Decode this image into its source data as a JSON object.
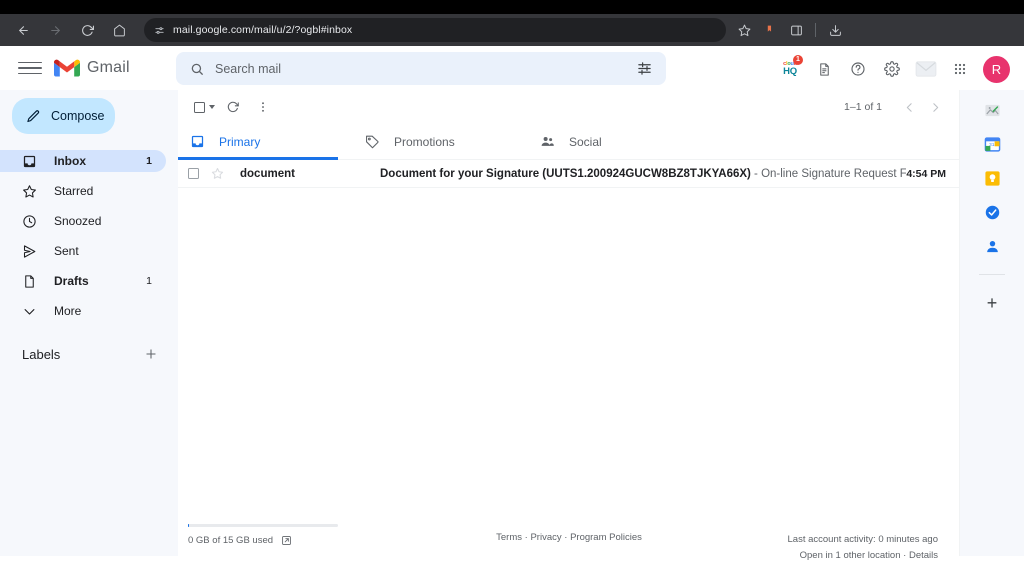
{
  "browser": {
    "url": "mail.google.com/mail/u/2/?ogbl#inbox",
    "back_icon": "back-arrow-icon",
    "forward_icon": "forward-arrow-icon",
    "reload_icon": "reload-icon",
    "home_icon": "home-icon",
    "site_settings_icon": "site-settings-icon",
    "bookmark_icon": "star-icon",
    "extension_icon": "extension-icon",
    "sidepanel_icon": "side-panel-icon",
    "download_icon": "download-icon"
  },
  "header": {
    "menu_icon": "hamburger-menu-icon",
    "logo_text": "Gmail",
    "search": {
      "placeholder": "Search mail",
      "value": "",
      "search_icon": "search-icon",
      "filter_icon": "tune-filter-icon"
    },
    "actions": {
      "cloudhq_top": "cloud",
      "cloudhq_bottom": "HQ",
      "cloudhq_badge": "1",
      "scan_icon": "document-scan-icon",
      "help_icon": "help-question-icon",
      "settings_icon": "settings-gear-icon",
      "envelope_icon": "envelope-icon",
      "apps_icon": "google-apps-grid-icon"
    },
    "avatar_initial": "R"
  },
  "sidebar": {
    "compose_label": "Compose",
    "compose_icon": "pencil-compose-icon",
    "items": [
      {
        "label": "Inbox",
        "count": "1",
        "icon": "inbox-icon",
        "active": true,
        "bold": true
      },
      {
        "label": "Starred",
        "count": "",
        "icon": "star-icon",
        "active": false,
        "bold": false
      },
      {
        "label": "Snoozed",
        "count": "",
        "icon": "clock-icon",
        "active": false,
        "bold": false
      },
      {
        "label": "Sent",
        "count": "",
        "icon": "send-icon",
        "active": false,
        "bold": false
      },
      {
        "label": "Drafts",
        "count": "1",
        "icon": "draft-file-icon",
        "active": false,
        "bold": true
      },
      {
        "label": "More",
        "count": "",
        "icon": "chevron-down-icon",
        "active": false,
        "bold": false
      }
    ],
    "labels_title": "Labels",
    "labels_add_icon": "plus-icon"
  },
  "list_toolbar": {
    "select_all_icon": "checkbox-icon",
    "select_caret_icon": "chevron-down-icon",
    "refresh_icon": "refresh-icon",
    "more_icon": "more-vertical-icon",
    "pagination_text": "1–1 of 1",
    "prev_icon": "chevron-left-icon",
    "next_icon": "chevron-right-icon"
  },
  "tabs": [
    {
      "label": "Primary",
      "icon": "inbox-tab-icon",
      "active": true
    },
    {
      "label": "Promotions",
      "icon": "tag-icon",
      "active": false
    },
    {
      "label": "Social",
      "icon": "people-icon",
      "active": false
    }
  ],
  "emails": [
    {
      "sender": "document",
      "subject": "Document for your Signature (UUTS1.200924GUCW8BZ8TJKYA66X)",
      "snippet": " - On-line Signature Request From Truecopy ...",
      "time": "4:54 PM",
      "checkbox_icon": "checkbox-icon",
      "star_icon": "star-outline-icon"
    }
  ],
  "footer": {
    "storage_text": "0 GB of 15 GB used",
    "storage_link_icon": "external-link-icon",
    "terms": "Terms",
    "privacy": "Privacy",
    "program_policies": "Program Policies",
    "separator": " · ",
    "last_activity": "Last account activity: 0 minutes ago",
    "open_location": "Open in 1 other location",
    "details": "Details"
  },
  "side_panel": {
    "items": [
      {
        "icon": "broken-image-icon"
      },
      {
        "icon": "google-calendar-icon"
      },
      {
        "icon": "google-keep-icon"
      },
      {
        "icon": "google-tasks-icon"
      },
      {
        "icon": "google-contacts-icon"
      }
    ],
    "add_label": "+",
    "add_icon": "plus-icon"
  },
  "colors": {
    "accent_blue": "#1a73e8",
    "compose_blue": "#c2e7ff",
    "active_nav_blue": "#d3e3fd",
    "sidebar_bg": "#f6f8fc",
    "avatar_pink": "#e8336d",
    "badge_red": "#ea4335",
    "chrome_bg": "#35363a"
  }
}
